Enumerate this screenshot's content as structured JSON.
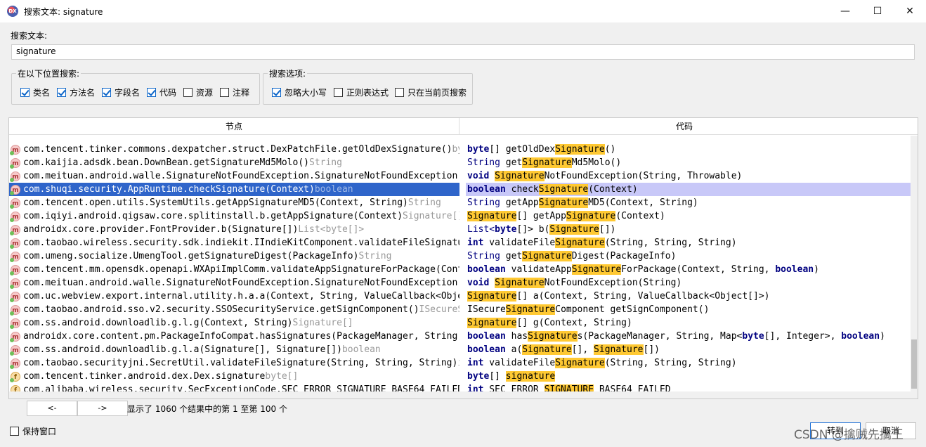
{
  "window": {
    "app_icon_text": "DX",
    "title": "搜索文本: signature",
    "controls": {
      "minimize": "—",
      "maximize": "☐",
      "close": "✕"
    }
  },
  "search": {
    "label": "搜索文本:",
    "value": "signature"
  },
  "scope_group": {
    "legend": "在以下位置搜索:",
    "options": [
      {
        "label": "类名",
        "checked": true
      },
      {
        "label": "方法名",
        "checked": true
      },
      {
        "label": "字段名",
        "checked": true
      },
      {
        "label": "代码",
        "checked": true
      },
      {
        "label": "资源",
        "checked": false
      },
      {
        "label": "注释",
        "checked": false
      }
    ]
  },
  "options_group": {
    "legend": "搜索选项:",
    "options": [
      {
        "label": "忽略大小写",
        "checked": true
      },
      {
        "label": "正则表达式",
        "checked": false
      },
      {
        "label": "只在当前页搜索",
        "checked": false
      }
    ]
  },
  "table": {
    "columns": [
      "节点",
      "代码"
    ],
    "rows": [
      {
        "icon": "m",
        "node": "com.tencent.tinker.commons.dexpatcher.struct.DexPatchFile.getOldDexSignature()",
        "type": "byte[]",
        "code": [
          [
            "kw",
            "byte"
          ],
          [
            "t",
            "[] getOldDex"
          ],
          [
            "h",
            "Signature"
          ],
          [
            "t",
            "()"
          ]
        ]
      },
      {
        "icon": "m",
        "node": "com.kaijia.adsdk.bean.DownBean.getSignatureMd5Molo()",
        "type": "String",
        "code": [
          [
            "cls",
            "String"
          ],
          [
            "t",
            " get"
          ],
          [
            "h",
            "Signature"
          ],
          [
            "t",
            "Md5Molo()"
          ]
        ]
      },
      {
        "icon": "m",
        "node": "com.meituan.android.walle.SignatureNotFoundException.SignatureNotFoundException(String, Throwable)",
        "type": "void",
        "code": [
          [
            "kw",
            "void"
          ],
          [
            "t",
            " "
          ],
          [
            "h",
            "Signature"
          ],
          [
            "t",
            "NotFoundException(String, Throwable)"
          ]
        ]
      },
      {
        "icon": "m",
        "node": "com.shuqi.security.AppRuntime.checkSignature(Context)",
        "type": "boolean",
        "selected": true,
        "code": [
          [
            "kw",
            "boolean"
          ],
          [
            "t",
            " check"
          ],
          [
            "h",
            "Signature"
          ],
          [
            "t",
            "(Context)"
          ]
        ]
      },
      {
        "icon": "m",
        "node": "com.tencent.open.utils.SystemUtils.getAppSignatureMD5(Context, String)",
        "type": "String",
        "code": [
          [
            "cls",
            "String"
          ],
          [
            "t",
            " getApp"
          ],
          [
            "h",
            "Signature"
          ],
          [
            "t",
            "MD5(Context, String)"
          ]
        ]
      },
      {
        "icon": "m",
        "node": "com.iqiyi.android.qigsaw.core.splitinstall.b.getAppSignature(Context)",
        "type": "Signature[]",
        "code": [
          [
            "h",
            "Signature"
          ],
          [
            "t",
            "[] getApp"
          ],
          [
            "h",
            "Signature"
          ],
          [
            "t",
            "(Context)"
          ]
        ]
      },
      {
        "icon": "m",
        "node": "androidx.core.provider.FontProvider.b(Signature[])",
        "type": "List<byte[]>",
        "code": [
          [
            "cls",
            "List<"
          ],
          [
            "kw",
            "byte"
          ],
          [
            "t",
            "[]> b("
          ],
          [
            "h",
            "Signature"
          ],
          [
            "t",
            "[])"
          ]
        ]
      },
      {
        "icon": "m",
        "node": "com.taobao.wireless.security.sdk.indiekit.IIndieKitComponent.validateFileSignature(String, String, String)",
        "type": "int",
        "code": [
          [
            "kw",
            "int"
          ],
          [
            "t",
            " validateFile"
          ],
          [
            "h",
            "Signature"
          ],
          [
            "t",
            "(String, String, String)"
          ]
        ]
      },
      {
        "icon": "m",
        "node": "com.umeng.socialize.UmengTool.getSignatureDigest(PackageInfo)",
        "type": "String",
        "code": [
          [
            "cls",
            "String"
          ],
          [
            "t",
            " get"
          ],
          [
            "h",
            "Signature"
          ],
          [
            "t",
            "Digest(PackageInfo)"
          ]
        ]
      },
      {
        "icon": "m",
        "node": "com.tencent.mm.opensdk.openapi.WXApiImplComm.validateAppSignatureForPackage(Context, String, boolean)",
        "type": "boolean",
        "code": [
          [
            "kw",
            "boolean"
          ],
          [
            "t",
            " validateApp"
          ],
          [
            "h",
            "Signature"
          ],
          [
            "t",
            "ForPackage(Context, String, "
          ],
          [
            "kw",
            "boolean"
          ],
          [
            "t",
            ")"
          ]
        ]
      },
      {
        "icon": "m",
        "node": "com.meituan.android.walle.SignatureNotFoundException.SignatureNotFoundException(String)",
        "type": "void",
        "code": [
          [
            "kw",
            "void"
          ],
          [
            "t",
            " "
          ],
          [
            "h",
            "Signature"
          ],
          [
            "t",
            "NotFoundException(String)"
          ]
        ]
      },
      {
        "icon": "m",
        "node": "com.uc.webview.export.internal.utility.h.a.a(Context, String, ValueCallback<Object[]>)",
        "type": "Signature[]",
        "code": [
          [
            "h",
            "Signature"
          ],
          [
            "t",
            "[] a(Context, String, ValueCallback<Object[]>)"
          ]
        ]
      },
      {
        "icon": "m",
        "node": "com.taobao.android.sso.v2.security.SSOSecurityService.getSignComponent()",
        "type": "ISecureSignatureComponent",
        "code": [
          [
            "t",
            "ISecure"
          ],
          [
            "h",
            "Signature"
          ],
          [
            "t",
            "Component getSignComponent()"
          ]
        ]
      },
      {
        "icon": "m",
        "node": "com.ss.android.downloadlib.g.l.g(Context, String)",
        "type": "Signature[]",
        "code": [
          [
            "h",
            "Signature"
          ],
          [
            "t",
            "[] g(Context, String)"
          ]
        ]
      },
      {
        "icon": "m",
        "node": "androidx.core.content.pm.PackageInfoCompat.hasSignatures(PackageManager, String, Map<byte[], Integer>, boolean)",
        "type": "boolean",
        "code": [
          [
            "kw",
            "boolean"
          ],
          [
            "t",
            " has"
          ],
          [
            "h",
            "Signature"
          ],
          [
            "t",
            "s(PackageManager, String, Map<"
          ],
          [
            "kw",
            "byte"
          ],
          [
            "t",
            "[], Integer>, "
          ],
          [
            "kw",
            "boolean"
          ],
          [
            "t",
            ")"
          ]
        ]
      },
      {
        "icon": "m",
        "node": "com.ss.android.downloadlib.g.l.a(Signature[], Signature[])",
        "type": "boolean",
        "code": [
          [
            "kw",
            "boolean"
          ],
          [
            "t",
            " a("
          ],
          [
            "h",
            "Signature"
          ],
          [
            "t",
            "[], "
          ],
          [
            "h",
            "Signature"
          ],
          [
            "t",
            "[])"
          ]
        ]
      },
      {
        "icon": "m",
        "node": "com.taobao.securityjni.SecretUtil.validateFileSignature(String, String, String)",
        "type": "int",
        "code": [
          [
            "kw",
            "int"
          ],
          [
            "t",
            " validateFile"
          ],
          [
            "h",
            "Signature"
          ],
          [
            "t",
            "(String, String, String)"
          ]
        ]
      },
      {
        "icon": "f",
        "node": "com.tencent.tinker.android.dex.Dex.signature",
        "type": "byte[]",
        "code": [
          [
            "kw",
            "byte"
          ],
          [
            "t",
            "[] "
          ],
          [
            "h",
            "signature"
          ]
        ]
      },
      {
        "icon": "f",
        "node": "com.alibaba.wireless.security.SecExceptionCode.SEC_ERROR_SIGNATURE_BASE64_FAILED",
        "type": "int",
        "code": [
          [
            "kw",
            "int"
          ],
          [
            "t",
            " SEC_ERROR_"
          ],
          [
            "h",
            "SIGNATURE"
          ],
          [
            "t",
            "_BASE64_FAILED"
          ]
        ]
      }
    ]
  },
  "pager": {
    "prev": "<-",
    "next": "->",
    "info": "显示了 1060 个结果中的第 1 至第 100 个"
  },
  "footer": {
    "keep_window": "保持窗口",
    "keep_checked": false,
    "goto_button": "转到",
    "cancel_button": "取消"
  },
  "watermark": "CSDN @擒贼先擒王"
}
